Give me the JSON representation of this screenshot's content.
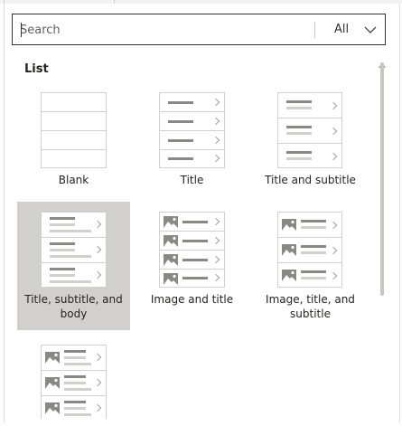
{
  "search": {
    "placeholder": "Search",
    "filter_label": "All"
  },
  "section": {
    "title": "List"
  },
  "tiles": [
    {
      "label": "Blank",
      "selected": false
    },
    {
      "label": "Title",
      "selected": false
    },
    {
      "label": "Title and subtitle",
      "selected": false
    },
    {
      "label": "Title, subtitle, and body",
      "selected": true
    },
    {
      "label": "Image and title",
      "selected": false
    },
    {
      "label": "Image, title, and subtitle",
      "selected": false
    }
  ],
  "icons": {
    "filter": "chevron-down-icon",
    "scroll_up": "scroll-up-arrow-icon",
    "row": "chevron-right-icon",
    "image": "image-placeholder-icon"
  }
}
